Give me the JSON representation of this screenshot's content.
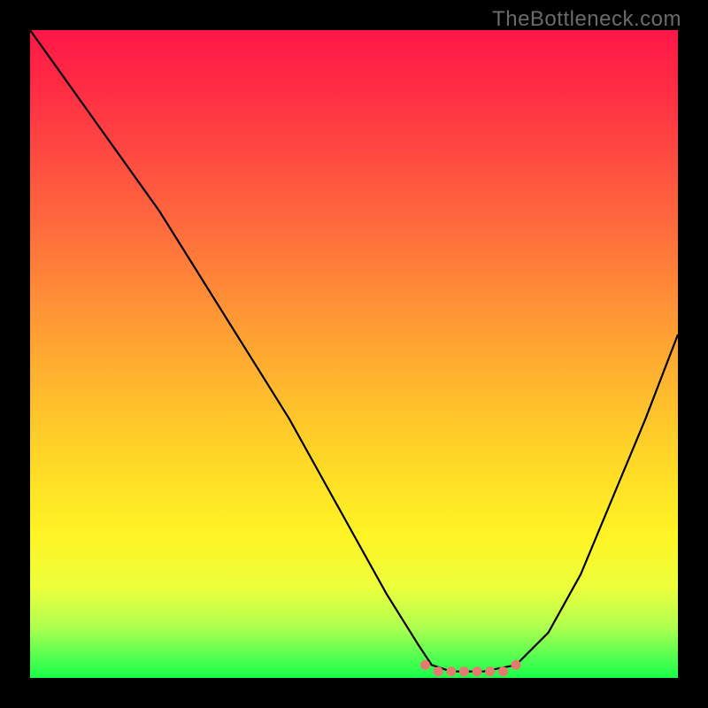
{
  "watermark_text": "TheBottleneck.com",
  "chart_data": {
    "type": "line",
    "title": "",
    "xlabel": "",
    "ylabel": "",
    "xlim": [
      0,
      100
    ],
    "ylim": [
      0,
      100
    ],
    "grid": false,
    "background": "red-to-green vertical gradient (bottleneck severity)",
    "series": [
      {
        "name": "bottleneck-curve",
        "x": [
          0,
          5,
          10,
          15,
          20,
          25,
          30,
          35,
          40,
          45,
          50,
          55,
          60,
          62,
          65,
          70,
          75,
          80,
          85,
          90,
          95,
          100
        ],
        "values": [
          100,
          93,
          86,
          79,
          72,
          64,
          56,
          48,
          40,
          31,
          22,
          13,
          5,
          2,
          1,
          1,
          2,
          7,
          16,
          28,
          40,
          53
        ]
      },
      {
        "name": "optimal-region-dots",
        "x": [
          61,
          63,
          65,
          67,
          69,
          71,
          73,
          75
        ],
        "values": [
          2,
          1,
          1,
          1,
          1,
          1,
          1,
          2
        ]
      }
    ]
  }
}
